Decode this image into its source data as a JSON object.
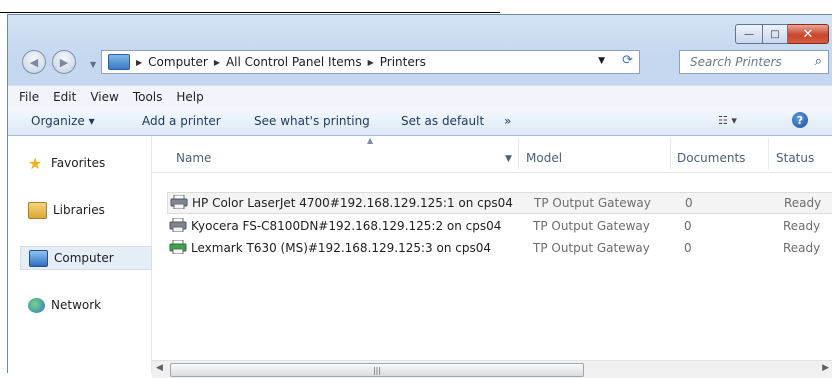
{
  "window": {
    "minimize_label": "—",
    "maximize_label": "□",
    "close_label": "✕"
  },
  "address": {
    "crumbs": [
      "Computer",
      "All Control Panel Items",
      "Printers"
    ],
    "search_placeholder": "Search Printers"
  },
  "menu": [
    "File",
    "Edit",
    "View",
    "Tools",
    "Help"
  ],
  "toolbar": {
    "organize": "Organize ▾",
    "add_printer": "Add a printer",
    "whats_printing": "See what's printing",
    "set_default": "Set as default",
    "more": "»"
  },
  "navpane": {
    "favorites": "Favorites",
    "libraries": "Libraries",
    "computer": "Computer",
    "network": "Network"
  },
  "columns": [
    "Name",
    "Model",
    "Documents",
    "Status"
  ],
  "printers": [
    {
      "name": "HP Color LaserJet 4700#192.168.129.125:1 on cps04",
      "model": "TP Output Gateway",
      "documents": "0",
      "status": "Ready"
    },
    {
      "name": "Kyocera FS-C8100DN#192.168.129.125:2 on cps04",
      "model": "TP Output Gateway",
      "documents": "0",
      "status": "Ready"
    },
    {
      "name": "Lexmark T630 (MS)#192.168.129.125:3 on cps04",
      "model": "TP Output Gateway",
      "documents": "0",
      "status": "Ready"
    }
  ],
  "colors": {
    "accent": "#1e395b",
    "selection": "#e5edf7"
  }
}
